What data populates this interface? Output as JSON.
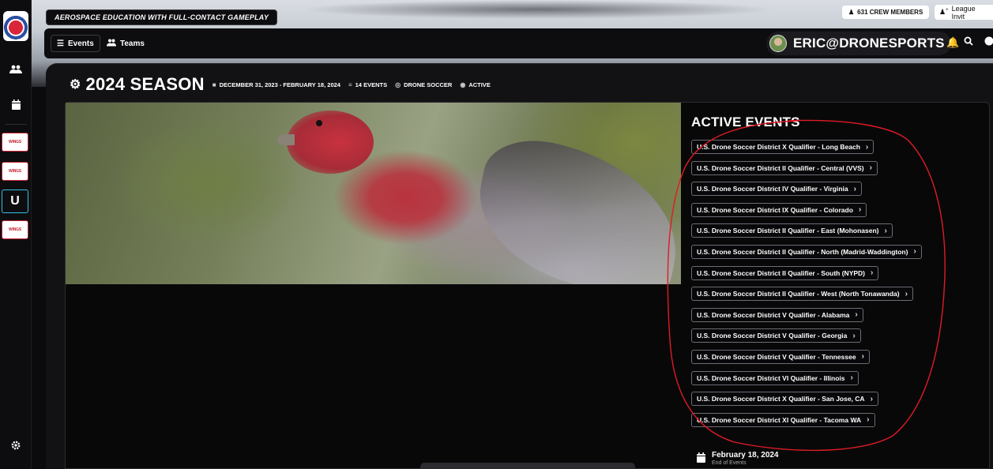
{
  "topbar": {
    "tagline": "AEROSPACE EDUCATION WITH FULL-CONTACT GAMEPLAY",
    "crew_count": "631 CREW MEMBERS",
    "invite_label": "League Invit"
  },
  "nav": {
    "events_label": "Events",
    "teams_label": "Teams",
    "user_name": "ERIC@DRONESPORTS"
  },
  "sidebar": {
    "badges": [
      "WINGS",
      "WINGS",
      "U",
      "WINGS"
    ]
  },
  "season": {
    "title": "2024 SEASON",
    "date_range": "DECEMBER 31, 2023 - FEBRUARY 18, 2024",
    "event_count": "14 EVENTS",
    "sport": "DRONE SOCCER",
    "status": "ACTIVE"
  },
  "active_events": {
    "heading": "ACTIVE EVENTS",
    "items": [
      "U.S. Drone Soccer District X Qualifier - Long Beach",
      "U.S. Drone Soccer District II Qualifier - Central (VVS)",
      "U.S. Drone Soccer District IV Qualifier - Virginia",
      "U.S. Drone Soccer District IX Qualifier - Colorado",
      "U.S. Drone Soccer District II Qualifier - East (Mohonasen)",
      "U.S. Drone Soccer District II Qualifier - North (Madrid-Waddington)",
      "U.S. Drone Soccer District II Qualifier - South (NYPD)",
      "U.S. Drone Soccer District II Qualifier - West (North Tonawanda)",
      "U.S. Drone Soccer District V Qualifier - Alabama",
      "U.S. Drone Soccer District V Qualifier - Georgia",
      "U.S. Drone Soccer District V Qualifier - Tennessee",
      "U.S. Drone Soccer District VI Qualifier - Illinois",
      "U.S. Drone Soccer District X Qualifier - San Jose, CA",
      "U.S. Drone Soccer District XI Qualifier - Tacoma WA"
    ]
  },
  "end": {
    "date": "February 18, 2024",
    "label": "End of Events"
  },
  "colors": {
    "annotation": "#e01b24",
    "cyan_badge": "#32c3e6",
    "badge_red": "#c42232"
  }
}
